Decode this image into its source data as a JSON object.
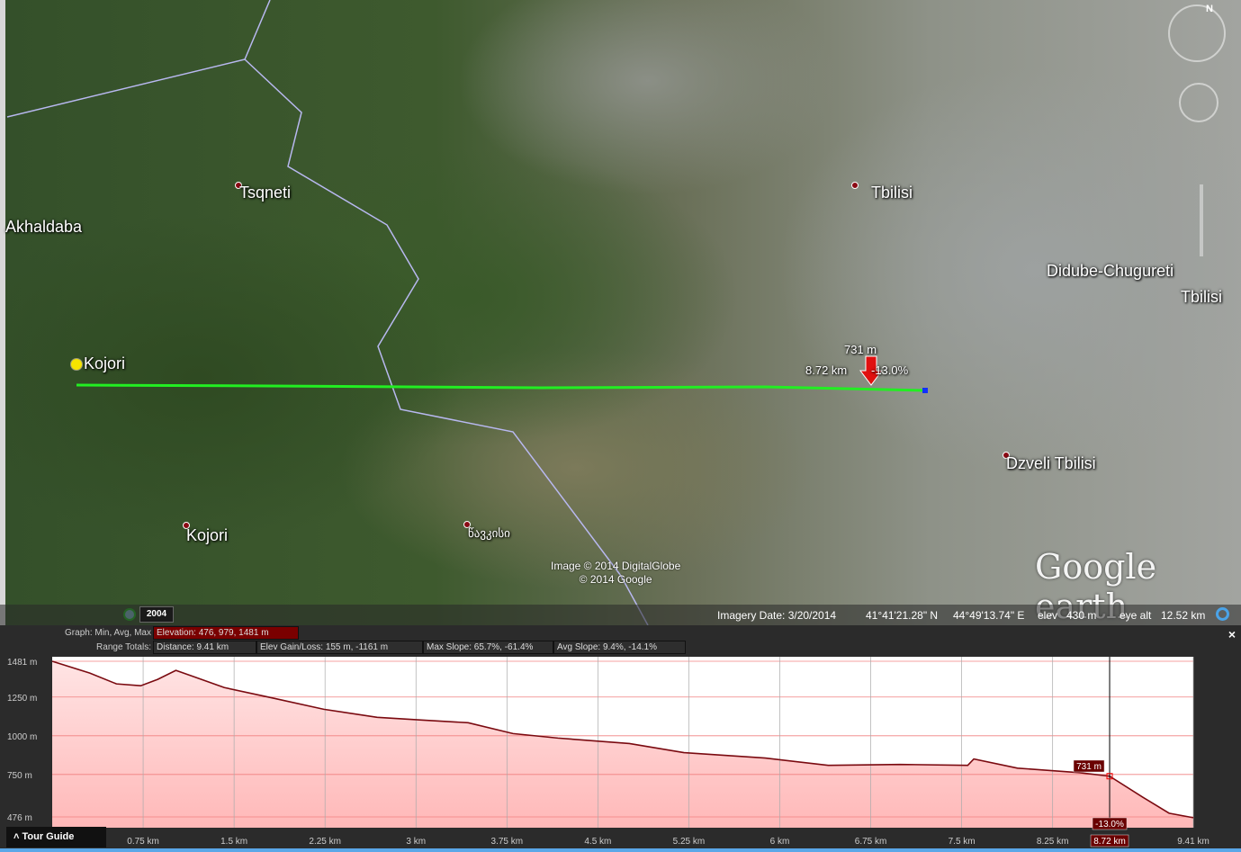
{
  "map": {
    "labels": [
      {
        "text": "Tsqneti",
        "pin": true
      },
      {
        "text": "Akhaldaba",
        "pin": false
      },
      {
        "text": "Kojori",
        "pin": false
      },
      {
        "text": "Kojori",
        "pin": true
      },
      {
        "text": "წავკისი",
        "pin": true
      },
      {
        "text": "Tbilisi",
        "pin": true
      },
      {
        "text": "Didube-Chugureti",
        "pin": false
      },
      {
        "text": "Tbilisi",
        "pin": false
      },
      {
        "text": "Dzveli Tbilisi",
        "pin": true
      }
    ],
    "path_marker": {
      "elevation": "731 m",
      "distance": "8.72 km",
      "slope": "-13.0%"
    },
    "copyright": [
      "Image © 2014 DigitalGlobe",
      "© 2014 Google"
    ],
    "logo": "Google earth",
    "historical_year": "2004",
    "status": {
      "imagery_date": "Imagery Date: 3/20/2014",
      "lat": "41°41'21.28\" N",
      "lon": "44°49'13.74\" E",
      "elev_label": "elev",
      "elev": "430 m",
      "eye_alt_label": "eye alt",
      "eye_alt": "12.52 km"
    },
    "path_color": "#22ee22"
  },
  "profile": {
    "graph_label": "Graph: Min, Avg, Max",
    "elevation": "Elevation: 476, 979, 1481 m",
    "range_label": "Range Totals:",
    "distance": "Distance: 9.41 km",
    "gain_loss": "Elev Gain/Loss: 155 m, -1161 m",
    "max_slope": "Max Slope: 65.7%, -61.4%",
    "avg_slope": "Avg Slope: 9.4%, -14.1%",
    "close": "×",
    "tour_guide": "Tour Guide"
  },
  "chart_data": {
    "type": "area",
    "xlabel": "Distance",
    "ylabel": "Elevation",
    "xlim": [
      0,
      9.41
    ],
    "ylim": [
      476,
      1481
    ],
    "y_ticks": [
      {
        "v": 1481,
        "label": "1481 m"
      },
      {
        "v": 1250,
        "label": "1250 m"
      },
      {
        "v": 1000,
        "label": "1000 m"
      },
      {
        "v": 750,
        "label": "750 m"
      },
      {
        "v": 476,
        "label": "476 m"
      }
    ],
    "x_ticks": [
      {
        "v": 0.75,
        "label": "0.75 km"
      },
      {
        "v": 1.5,
        "label": "1.5 km"
      },
      {
        "v": 2.25,
        "label": "2.25 km"
      },
      {
        "v": 3,
        "label": "3 km"
      },
      {
        "v": 3.75,
        "label": "3.75 km"
      },
      {
        "v": 4.5,
        "label": "4.5 km"
      },
      {
        "v": 5.25,
        "label": "5.25 km"
      },
      {
        "v": 6,
        "label": "6 km"
      },
      {
        "v": 6.75,
        "label": "6.75 km"
      },
      {
        "v": 7.5,
        "label": "7.5 km"
      },
      {
        "v": 8.25,
        "label": "8.25 km"
      },
      {
        "v": 9.41,
        "label": "9.41 km"
      }
    ],
    "x": [
      0,
      0.31,
      0.53,
      0.73,
      0.87,
      1.02,
      1.17,
      1.42,
      1.8,
      2.24,
      2.68,
      3.06,
      3.43,
      3.8,
      4.17,
      4.76,
      5.21,
      5.88,
      6.4,
      6.99,
      7.55,
      7.6,
      7.96,
      8.47,
      8.72,
      8.99,
      9.21,
      9.41
    ],
    "y": [
      1481,
      1405,
      1335,
      1323,
      1364,
      1422,
      1381,
      1311,
      1247,
      1171,
      1119,
      1101,
      1084,
      1014,
      985,
      950,
      891,
      856,
      809,
      815,
      809,
      850,
      791,
      762,
      739,
      605,
      500,
      471
    ],
    "cursor": {
      "x": 8.72,
      "x_label": "8.72 km",
      "y_label": "731 m",
      "slope_label": "-13.0%"
    },
    "fill_color": "#ffb8b8",
    "line_color": "#7a0a10"
  }
}
